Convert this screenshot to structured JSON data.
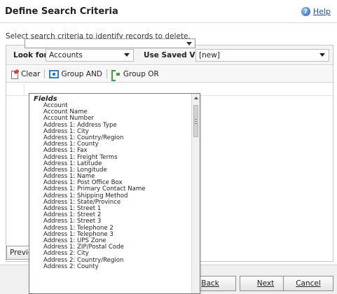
{
  "dialog": {
    "title": "Define Search Criteria",
    "help_label": "Help",
    "intro": "Select search criteria to identify records to delete."
  },
  "look_for": {
    "label": "Look for:",
    "value": "Accounts"
  },
  "saved_view": {
    "label": "Use Saved View:",
    "value": "[new]"
  },
  "toolbar": {
    "clear": "Clear",
    "group_and": "Group AND",
    "group_or": "Group OR"
  },
  "field_dropdown": {
    "group_label": "Fields",
    "items": [
      "Account",
      "Account Name",
      "Account Number",
      "Address 1: Address Type",
      "Address 1: City",
      "Address 1: Country/Region",
      "Address 1: County",
      "Address 1: Fax",
      "Address 1: Freight Terms",
      "Address 1: Latitude",
      "Address 1: Longitude",
      "Address 1: Name",
      "Address 1: Post Office Box",
      "Address 1: Primary Contact Name",
      "Address 1: Shipping Method",
      "Address 1: State/Province",
      "Address 1: Street 1",
      "Address 1: Street 2",
      "Address 1: Street 3",
      "Address 1: Telephone 2",
      "Address 1: Telephone 3",
      "Address 1: UPS Zone",
      "Address 1: ZIP/Postal Code",
      "Address 2: City",
      "Address 2: Country/Region",
      "Address 2: County"
    ]
  },
  "footer": {
    "preview": "Preview",
    "back": "Back",
    "next": "Next",
    "cancel": "Cancel"
  }
}
